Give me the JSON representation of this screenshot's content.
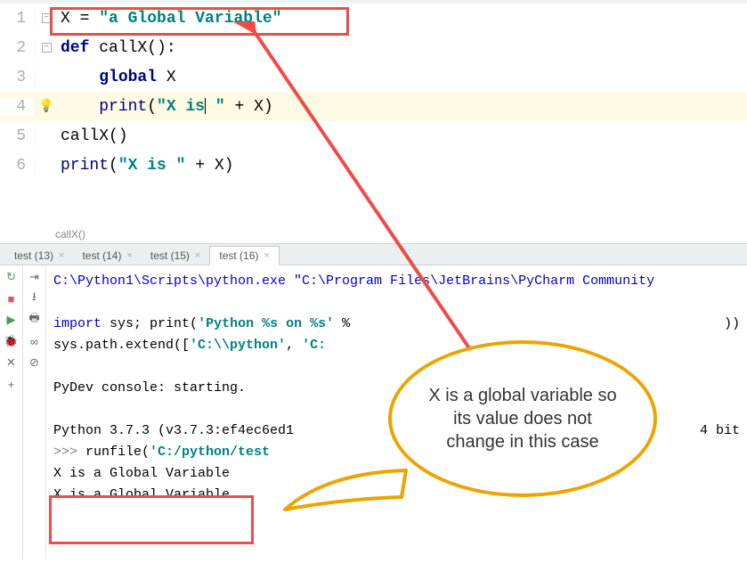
{
  "editor": {
    "lines": {
      "l1": "1",
      "l2": "2",
      "l3": "3",
      "l4": "4",
      "l5": "5",
      "l6": "6"
    },
    "code1_var": "X ",
    "code1_eq": "= ",
    "code1_str": "\"a Global Variable\"",
    "code2_def": "def",
    "code2_name": " callX():",
    "code3_global": "global",
    "code3_x": " X",
    "code4_print": "print",
    "code4_open": "(",
    "code4_str": "\"X is",
    "code4_str2": " \"",
    "code4_plus": " + X)",
    "code5": "callX()",
    "code6_print": "print",
    "code6_open": "(",
    "code6_str": "\"X is \"",
    "code6_plus": " + X)"
  },
  "breadcrumb": "callX()",
  "tabs": {
    "t1": "test (13)",
    "t2": "test (14)",
    "t3": "test (15)",
    "t4": "test (16)"
  },
  "console": {
    "line1": "C:\\Python1\\Scripts\\python.exe \"C:\\Program Files\\JetBrains\\PyCharm Community",
    "line2a": "import",
    "line2b": " sys; ",
    "line2c": "print",
    "line2d": "(",
    "line2e": "'Python %s on %s'",
    "line2f": " %",
    "line2g": "))",
    "line3a": "sys.path.extend([",
    "line3b": "'C:\\\\python'",
    "line3c": ", ",
    "line3d": "'C:",
    "line5": "PyDev console: starting.",
    "line7": "Python 3.7.3 (v3.7.3:ef4ec6ed1",
    "line7b": "4 bit",
    "prompt": ">>> ",
    "line8a": "runfile(",
    "line8b": "'C:/python/test",
    "out1": "X is a Global Variable",
    "out2": "X is a Global Variable"
  },
  "callout_text": "X is a global variable so its value does not change in this case"
}
